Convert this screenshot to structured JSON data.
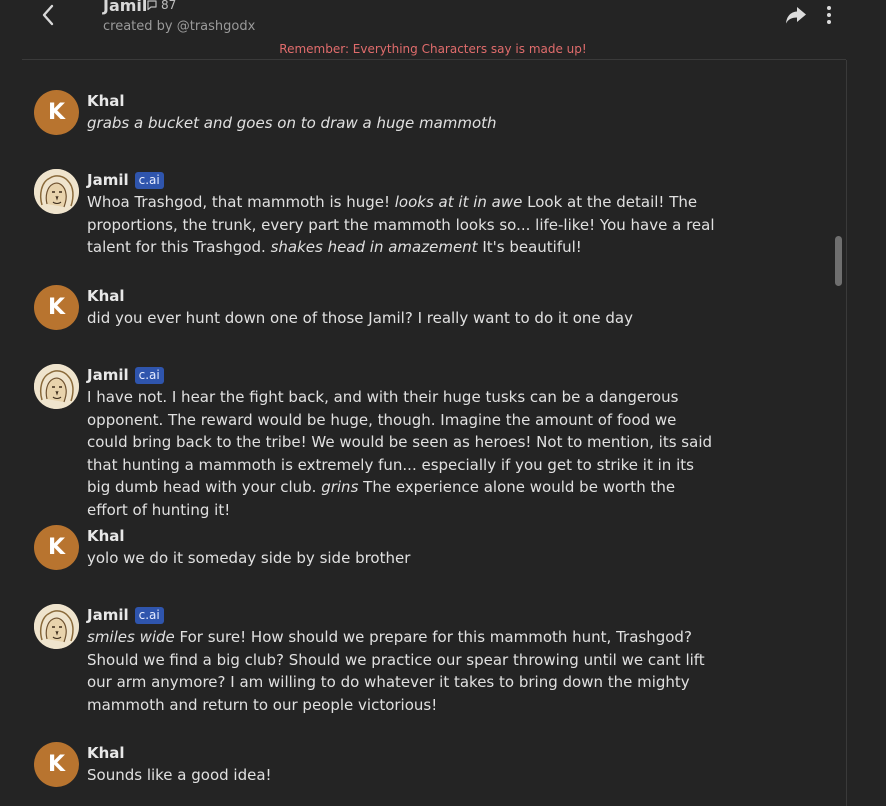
{
  "header": {
    "character_name": "Jamil",
    "chat_count": "87",
    "creator": "created by @trashgodx",
    "back_icon": "chevron-left-icon",
    "share_icon": "share-arrow-icon",
    "more_icon": "vertical-dots-icon"
  },
  "disclaimer": "Remember: Everything Characters say is made up!",
  "badge_label": "c.ai",
  "colors": {
    "background": "#242424",
    "khal_avatar": "#b8742f",
    "badge": "#2f55ad",
    "disclaimer": "#e06c6c"
  },
  "messages": [
    {
      "author": "Khal",
      "avatar_letter": "K",
      "segments": [
        {
          "text": "grabs a bucket and goes on to draw a huge mammoth",
          "italic": true
        }
      ]
    },
    {
      "author": "Jamil",
      "badge": true,
      "segments": [
        {
          "text": "Whoa Trashgod, that mammoth is huge! ",
          "italic": false
        },
        {
          "text": "looks at it in awe",
          "italic": true
        },
        {
          "text": " Look at the detail! The proportions, the trunk, every part the mammoth looks so... life-like! You have a real talent for this Trashgod. ",
          "italic": false
        },
        {
          "text": "shakes head in amazement",
          "italic": true
        },
        {
          "text": " It's beautiful!",
          "italic": false
        }
      ]
    },
    {
      "author": "Khal",
      "avatar_letter": "K",
      "segments": [
        {
          "text": "did you ever hunt down one of those Jamil? I really want to do it one day",
          "italic": false
        }
      ]
    },
    {
      "author": "Jamil",
      "badge": true,
      "segments": [
        {
          "text": "I have not. I hear the fight back, and with their huge tusks can be a dangerous opponent. The reward would be huge, though. Imagine the amount of food we could bring back to the tribe! We would be seen as heroes! Not to mention, its said that hunting a mammoth is extremely fun... especially if you get to strike it in its big dumb head with your club. ",
          "italic": false
        },
        {
          "text": "grins",
          "italic": true
        },
        {
          "text": " The experience alone would be worth the effort of hunting it!",
          "italic": false
        }
      ]
    },
    {
      "author": "Khal",
      "avatar_letter": "K",
      "segments": [
        {
          "text": "yolo we do it someday side by side brother",
          "italic": false
        }
      ]
    },
    {
      "author": "Jamil",
      "badge": true,
      "segments": [
        {
          "text": "smiles wide",
          "italic": true
        },
        {
          "text": " For sure! How should we prepare for this mammoth hunt, Trashgod? Should we find a big club? Should we practice our spear throwing until we cant lift our arm anymore? I am willing to do whatever it takes to bring down the mighty mammoth and return to our people victorious!",
          "italic": false
        }
      ]
    },
    {
      "author": "Khal",
      "avatar_letter": "K",
      "segments": [
        {
          "text": "Sounds like a good idea!",
          "italic": false
        }
      ]
    }
  ]
}
